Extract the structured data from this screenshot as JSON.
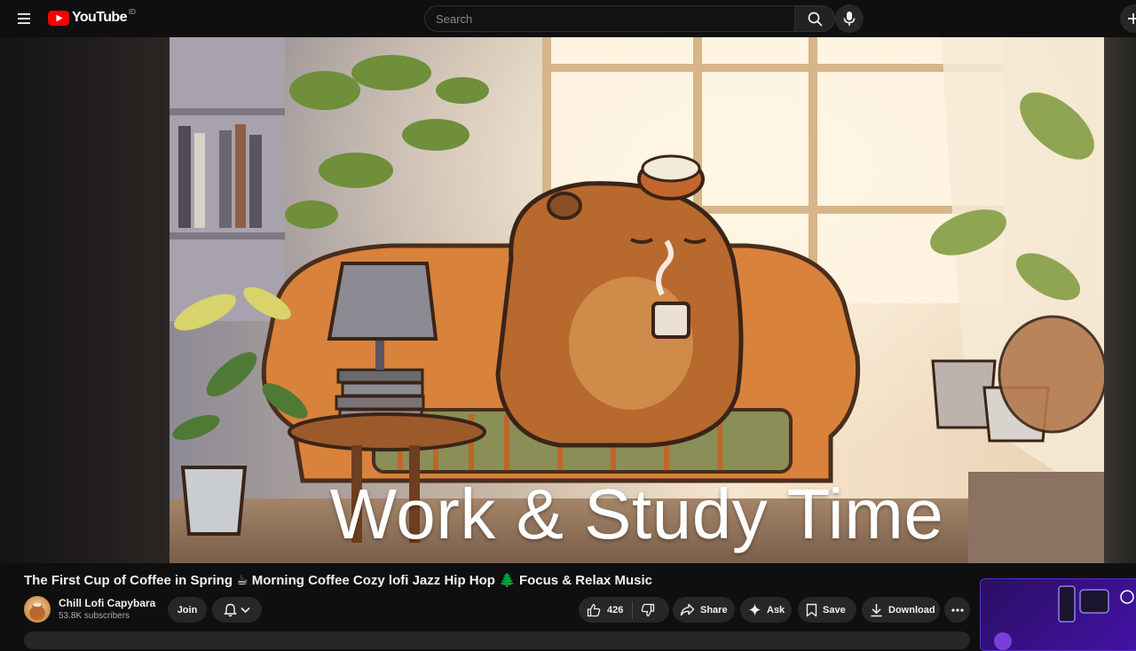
{
  "masthead": {
    "logo_text": "YouTube",
    "country_code": "ID",
    "search_placeholder": "Search",
    "icons": [
      "menu-icon",
      "youtube-play-icon",
      "search-icon",
      "mic-icon",
      "create-icon"
    ]
  },
  "player": {
    "overlay_text": "Work & Study Time"
  },
  "video": {
    "title": "The First Cup of Coffee in Spring ☕ Morning Coffee Cozy lofi Jazz Hip Hop 🌲 Focus & Relax Music"
  },
  "channel": {
    "name": "Chill Lofi Capybara",
    "subscribers": "53.8K subscribers",
    "join_label": "Join"
  },
  "actions": {
    "like_count": "426",
    "share_label": "Share",
    "ask_label": "Ask",
    "save_label": "Save",
    "download_label": "Download"
  },
  "colors": {
    "background": "#0f0f0f",
    "button": "#272727",
    "brand_red": "#ff0000",
    "text_primary": "#f1f1f1",
    "text_secondary": "#aaaaaa"
  }
}
